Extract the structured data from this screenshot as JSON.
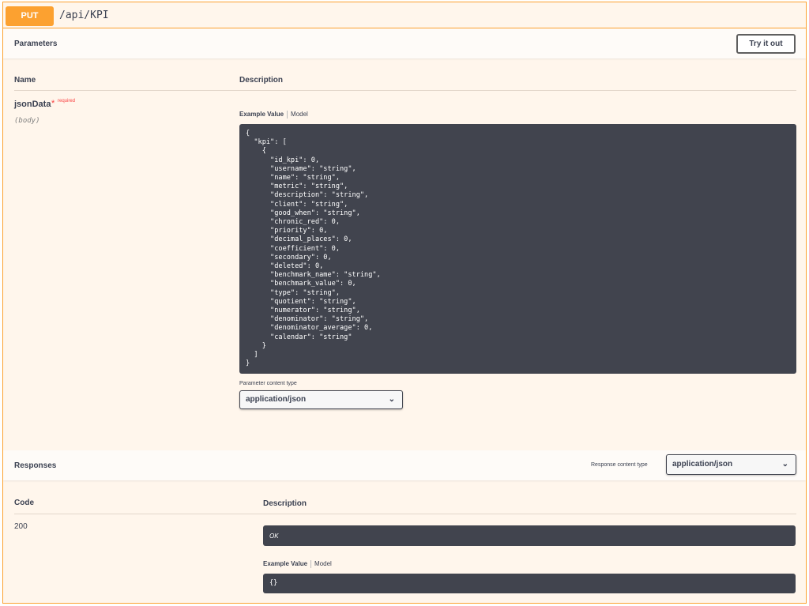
{
  "operation": {
    "method": "PUT",
    "path": "/api/KPI"
  },
  "parameters": {
    "title": "Parameters",
    "try_button": "Try it out",
    "col_name": "Name",
    "col_description": "Description",
    "param": {
      "name": "jsonData",
      "required_star": "*",
      "required_text": "required",
      "location": "(body)"
    },
    "tabs": {
      "example": "Example Value",
      "model": "Model"
    },
    "example_json": "{\n  \"kpi\": [\n    {\n      \"id_kpi\": 0,\n      \"username\": \"string\",\n      \"name\": \"string\",\n      \"metric\": \"string\",\n      \"description\": \"string\",\n      \"client\": \"string\",\n      \"good_when\": \"string\",\n      \"chronic_red\": 0,\n      \"priority\": 0,\n      \"decimal_places\": 0,\n      \"coefficient\": 0,\n      \"secondary\": 0,\n      \"deleted\": 0,\n      \"benchmark_name\": \"string\",\n      \"benchmark_value\": 0,\n      \"type\": \"string\",\n      \"quotient\": \"string\",\n      \"numerator\": \"string\",\n      \"denominator\": \"string\",\n      \"denominator_average\": 0,\n      \"calendar\": \"string\"\n    }\n  ]\n}",
    "content_type_label": "Parameter content type",
    "content_type_value": "application/json"
  },
  "responses": {
    "title": "Responses",
    "content_type_label": "Response content type",
    "content_type_value": "application/json",
    "col_code": "Code",
    "col_description": "Description",
    "rows": [
      {
        "code": "200",
        "description": "OK",
        "example": "{}"
      }
    ],
    "tabs": {
      "example": "Example Value",
      "model": "Model"
    }
  },
  "colors": {
    "put_accent": "#fca130",
    "code_background": "#41444e",
    "required": "#f93e3e"
  }
}
